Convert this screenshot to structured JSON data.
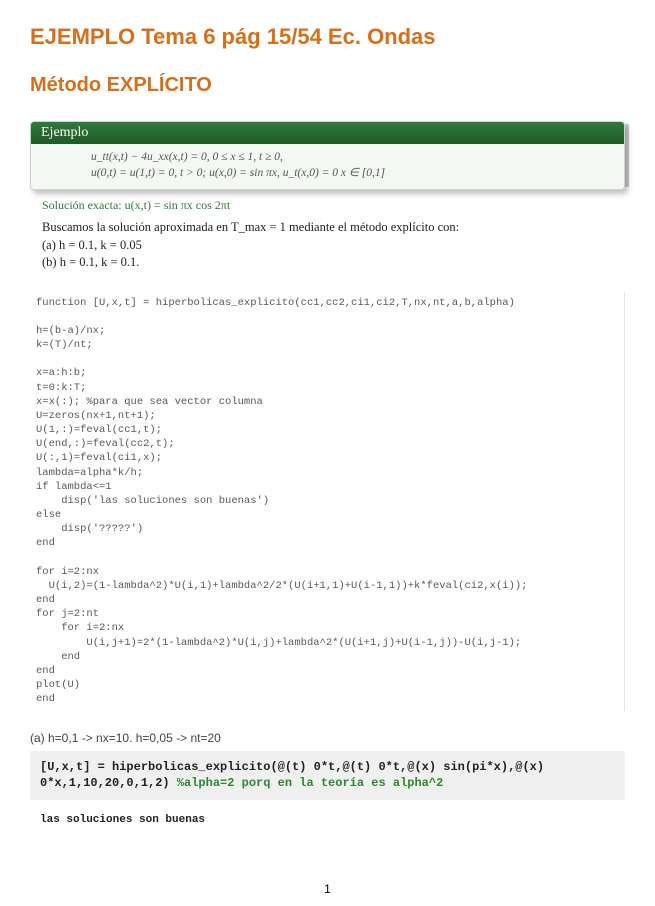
{
  "title": "EJEMPLO Tema 6 pág 15/54 Ec. Ondas",
  "subtitle": "Método EXPLÍCITO",
  "example": {
    "header": "Ejemplo",
    "line1": "u_tt(x,t) − 4u_xx(x,t) = 0,   0 ≤ x ≤ 1,  t ≥ 0,",
    "line2": "u(0,t) = u(1,t) = 0, t > 0;   u(x,0) = sin πx, u_t(x,0) = 0  x ∈ [0,1]"
  },
  "solution_exact": "Solución exacta: u(x,t) = sin πx cos 2πt",
  "buscamos": {
    "line1": "Buscamos la solución aproximada en T_max = 1 mediante el método explícito con:",
    "line2": "(a) h = 0.1, k = 0.05",
    "line3": "(b) h = 0.1, k = 0.1."
  },
  "code": "function [U,x,t] = hiperbolicas_explicito(cc1,cc2,ci1,ci2,T,nx,nt,a,b,alpha)\n\nh=(b-a)/nx;\nk=(T)/nt;\n\nx=a:h:b;\nt=0:k:T;\nx=x(:); %para que sea vector columna\nU=zeros(nx+1,nt+1);\nU(1,:)=feval(cc1,t);\nU(end,:)=feval(cc2,t);\nU(:,1)=feval(ci1,x);\nlambda=alpha*k/h;\nif lambda<=1\n    disp('las soluciones son buenas')\nelse\n    disp('?????')\nend\n\nfor i=2:nx\n  U(i,2)=(1-lambda^2)*U(i,1)+lambda^2/2*(U(i+1,1)+U(i-1,1))+k*feval(ci2,x(i));\nend\nfor j=2:nt\n    for i=2:nx\n        U(i,j+1)=2*(1-lambda^2)*U(i,j)+lambda^2*(U(i+1,j)+U(i-1,j))-U(i,j-1);\n    end\nend\nplot(U)\nend",
  "case_label": "(a) h=0,1 -> nx=10. h=0,05 -> nt=20",
  "cmd": {
    "part1": "[U,x,t] = hiperbolicas_explicito(@(t) 0*t,@(t) 0*t,@(x) sin(pi*x),@(x) 0*x,1,10,20,0,1,2) ",
    "comment": "%alpha=2 porq en la teoría es alpha^2"
  },
  "output": "las soluciones son buenas",
  "page_number": "1"
}
